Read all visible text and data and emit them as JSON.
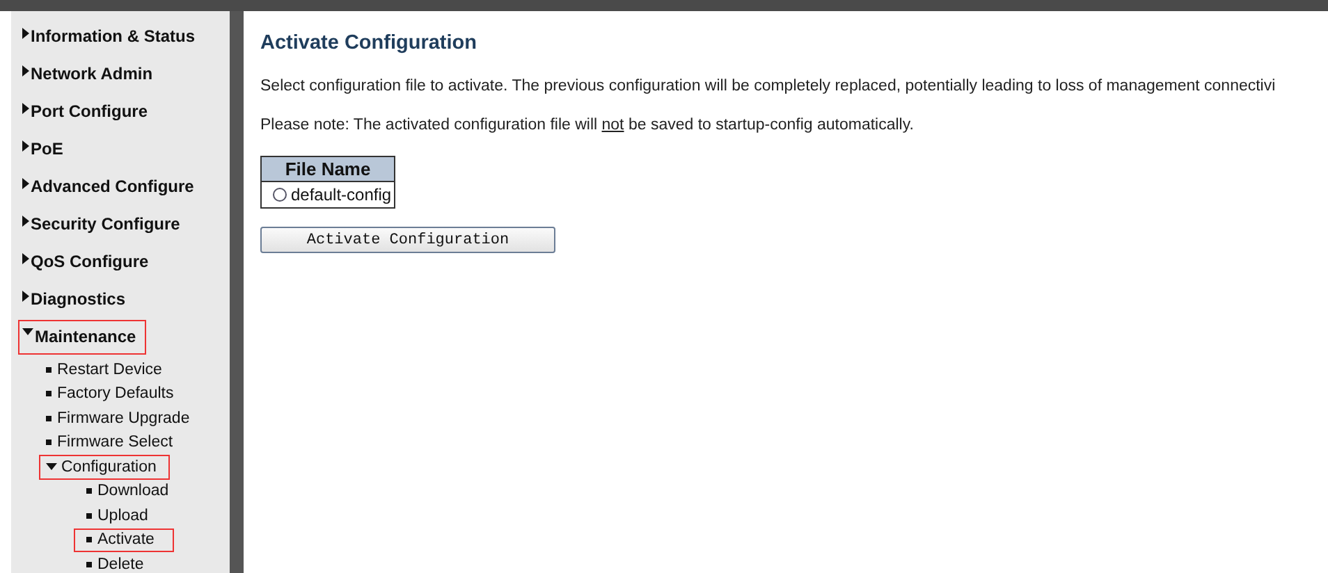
{
  "sidebar": {
    "items": [
      {
        "label": "Information & Status",
        "expanded": false,
        "highlighted": false
      },
      {
        "label": "Network Admin",
        "expanded": false,
        "highlighted": false
      },
      {
        "label": "Port Configure",
        "expanded": false,
        "highlighted": false
      },
      {
        "label": "PoE",
        "expanded": false,
        "highlighted": false
      },
      {
        "label": "Advanced Configure",
        "expanded": false,
        "highlighted": false
      },
      {
        "label": "Security Configure",
        "expanded": false,
        "highlighted": false
      },
      {
        "label": "QoS Configure",
        "expanded": false,
        "highlighted": false
      },
      {
        "label": "Diagnostics",
        "expanded": false,
        "highlighted": false
      },
      {
        "label": "Maintenance",
        "expanded": true,
        "highlighted": true,
        "children": [
          {
            "label": "Restart Device",
            "highlighted": false
          },
          {
            "label": "Factory Defaults",
            "highlighted": false
          },
          {
            "label": "Firmware Upgrade",
            "highlighted": false
          },
          {
            "label": "Firmware Select",
            "highlighted": false
          },
          {
            "label": "Configuration",
            "expanded": true,
            "highlighted": true,
            "children": [
              {
                "label": "Download",
                "highlighted": false
              },
              {
                "label": "Upload",
                "highlighted": false
              },
              {
                "label": "Activate",
                "highlighted": true
              },
              {
                "label": "Delete",
                "highlighted": false
              }
            ]
          }
        ]
      }
    ]
  },
  "main": {
    "title": "Activate Configuration",
    "paragraphs": [
      "Select configuration file to activate. The previous configuration will be completely replaced, potentially leading to loss of management connectivi",
      [
        {
          "text": "Please note: The activated configuration file will ",
          "underline": false
        },
        {
          "text": "not",
          "underline": true
        },
        {
          "text": " be saved to startup-config automatically.",
          "underline": false
        }
      ]
    ],
    "table": {
      "columns": [
        "File Name"
      ],
      "rows": [
        {
          "label": "default-config",
          "selected": false
        }
      ]
    },
    "button": "Activate Configuration"
  }
}
